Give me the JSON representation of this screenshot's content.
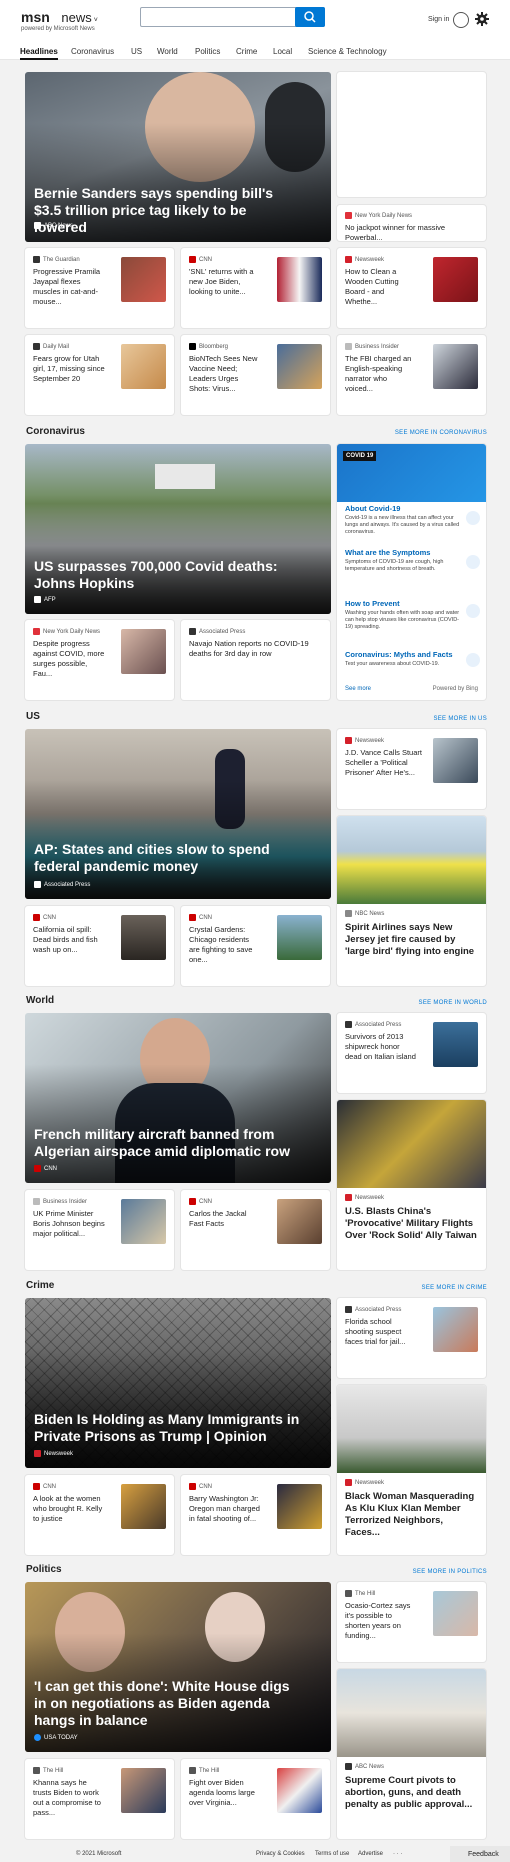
{
  "header": {
    "brand": "msn",
    "product": "news",
    "powered": "powered by Microsoft News",
    "search_placeholder": "",
    "signin": "Sign in"
  },
  "nav": [
    "Headlines",
    "Coronavirus",
    "US",
    "World",
    "Politics",
    "Crime",
    "Local",
    "Science & Technology"
  ],
  "top": {
    "hero": {
      "title": "Bernie Sanders says spending bill's $3.5 trillion price tag likely to be lowered",
      "source": "ABC News"
    },
    "right1": {
      "source": "New York Daily News",
      "title": "No jackpot winner for massive Powerbal..."
    },
    "row1": [
      {
        "source": "The Guardian",
        "title": "Progressive Pramila Jayapal flexes muscles in cat-and-mouse..."
      },
      {
        "source": "CNN",
        "title": "'SNL' returns with a new Joe Biden, looking to unite..."
      },
      {
        "source": "Newsweek",
        "title": "How to Clean a Wooden Cutting Board - and Whethe..."
      }
    ],
    "row2": [
      {
        "source": "Daily Mail",
        "title": "Fears grow for Utah girl, 17, missing since September 20"
      },
      {
        "source": "Bloomberg",
        "title": "BioNTech Sees New Vaccine Need; Leaders Urges Shots: Virus..."
      },
      {
        "source": "Business Insider",
        "title": "The FBI charged an English-speaking narrator who voiced..."
      }
    ]
  },
  "coronavirus": {
    "heading": "Coronavirus",
    "see_more": "SEE MORE IN CORONAVIRUS",
    "hero": {
      "title": "US surpasses 700,000 Covid deaths: Johns Hopkins",
      "source": "AFP"
    },
    "row": [
      {
        "source": "New York Daily News",
        "title": "Despite progress against COVID, more surges possible, Fau..."
      },
      {
        "source": "Associated Press",
        "title": "Navajo Nation reports no COVID-19 deaths for 3rd day in row"
      }
    ],
    "panel": {
      "tag": "COVID 19",
      "items": [
        {
          "title": "About Covid-19",
          "text": "Covid-19 is a new illness that can affect your lungs and airways. It's caused by a virus called coronavirus."
        },
        {
          "title": "What are the Symptoms",
          "text": "Symptoms of COVID-19 are cough, high temperature and shortness of breath."
        },
        {
          "title": "How to Prevent",
          "text": "Washing your hands often with soap and water can help stop viruses like coronavirus (COVID-19) spreading."
        },
        {
          "title": "Coronavirus: Myths and Facts",
          "text": "Test your awareness about COVID-19."
        }
      ],
      "see_more": "See more",
      "powered": "Powered by Bing"
    }
  },
  "us": {
    "heading": "US",
    "see_more": "SEE MORE IN US",
    "hero": {
      "title": "AP: States and cities slow to spend federal pandemic money",
      "source": "Associated Press"
    },
    "side": {
      "source": "Newsweek",
      "title": "J.D. Vance Calls Stuart Scheller a 'Political Prisoner' After He's..."
    },
    "tall": {
      "source": "NBC News",
      "title": "Spirit Airlines says New Jersey jet fire caused by 'large bird' flying into engine"
    },
    "row": [
      {
        "source": "CNN",
        "title": "California oil spill: Dead birds and fish wash up on..."
      },
      {
        "source": "CNN",
        "title": "Crystal Gardens: Chicago residents are fighting to save one..."
      }
    ]
  },
  "world": {
    "heading": "World",
    "see_more": "SEE MORE IN WORLD",
    "hero": {
      "title": "French military aircraft banned from Algerian airspace amid diplomatic row",
      "source": "CNN"
    },
    "side": {
      "source": "Associated Press",
      "title": "Survivors of 2013 shipwreck honor dead on Italian island"
    },
    "tall": {
      "source": "Newsweek",
      "title": "U.S. Blasts China's 'Provocative' Military Flights Over 'Rock Solid' Ally Taiwan"
    },
    "row": [
      {
        "source": "Business Insider",
        "title": "UK Prime Minister Boris Johnson begins major political..."
      },
      {
        "source": "CNN",
        "title": "Carlos the Jackal Fast Facts"
      }
    ]
  },
  "crime": {
    "heading": "Crime",
    "see_more": "SEE MORE IN CRIME",
    "hero": {
      "title": "Biden Is Holding as Many Immigrants in Private Prisons as Trump | Opinion",
      "source": "Newsweek"
    },
    "side": {
      "source": "Associated Press",
      "title": "Florida school shooting suspect faces trial for jail..."
    },
    "tall": {
      "source": "Newsweek",
      "title": "Black Woman Masquerading As Klu Klux Klan Member Terrorized Neighbors, Faces..."
    },
    "row": [
      {
        "source": "CNN",
        "title": "A look at the women who brought R. Kelly to justice"
      },
      {
        "source": "CNN",
        "title": "Barry Washington Jr: Oregon man charged in fatal shooting of..."
      }
    ]
  },
  "politics": {
    "heading": "Politics",
    "see_more": "SEE MORE IN POLITICS",
    "hero": {
      "title": "'I can get this done': White House digs in on negotiations as Biden agenda hangs in balance",
      "source": "USA TODAY"
    },
    "side": {
      "source": "The Hill",
      "title": "Ocasio-Cortez says it's possible to shorten years on funding..."
    },
    "tall": {
      "source": "ABC News",
      "title": "Supreme Court pivots to abortion, guns, and death penalty as public approval..."
    },
    "row": [
      {
        "source": "The Hill",
        "title": "Khanna says he trusts Biden to work out a compromise to pass..."
      },
      {
        "source": "The Hill",
        "title": "Fight over Biden agenda looms large over Virginia..."
      }
    ]
  },
  "footer": {
    "copyright": "© 2021 Microsoft",
    "privacy": "Privacy & Cookies",
    "terms": "Terms of use",
    "advertise": "Advertise",
    "more": "· · ·",
    "feedback": "Feedback"
  },
  "colors": {
    "accent": "#0078d4",
    "cnn": "#cc0000",
    "newsweek": "#d4202a"
  }
}
